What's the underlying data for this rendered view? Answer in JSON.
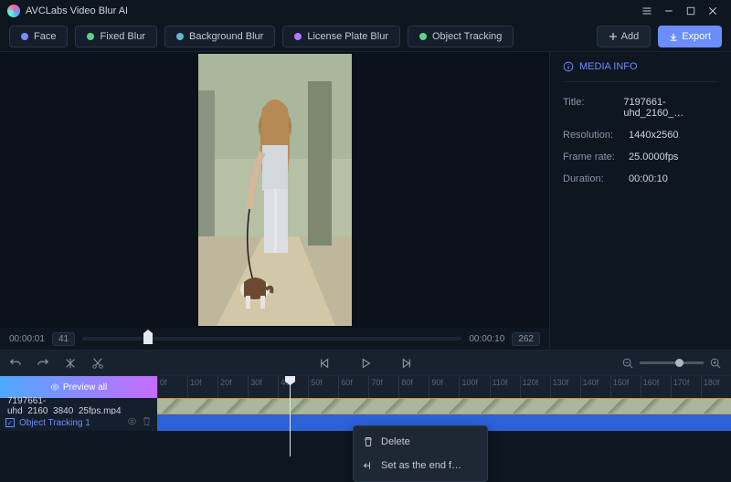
{
  "app_title": "AVCLabs Video Blur AI",
  "modes": {
    "face": "Face",
    "fixed": "Fixed Blur",
    "bg": "Background Blur",
    "plate": "License Plate Blur",
    "obj": "Object Tracking"
  },
  "toolbar": {
    "add": "Add",
    "export": "Export"
  },
  "scrub": {
    "cur_time": "00:00:01",
    "cur_frame": "41",
    "end_time": "00:00:10",
    "end_frame": "262"
  },
  "media_info": {
    "heading": "MEDIA INFO",
    "title_label": "Title:",
    "title_value": "7197661-uhd_2160_…",
    "res_label": "Resolution:",
    "res_value": "1440x2560",
    "fps_label": "Frame rate:",
    "fps_value": "25.0000fps",
    "dur_label": "Duration:",
    "dur_value": "00:00:10"
  },
  "timeline": {
    "preview_all": "Preview all",
    "clip_name": "7197661-uhd_2160_3840_25fps.mp4",
    "track2": "Object Tracking 1",
    "ticks": [
      "0f",
      "10f",
      "20f",
      "30f",
      "40f",
      "50f",
      "60f",
      "70f",
      "80f",
      "90f",
      "100f",
      "110f",
      "120f",
      "130f",
      "140f",
      "150f",
      "160f",
      "170f",
      "180f"
    ]
  },
  "context_menu": {
    "delete": "Delete",
    "set_end": "Set as the end f…"
  }
}
